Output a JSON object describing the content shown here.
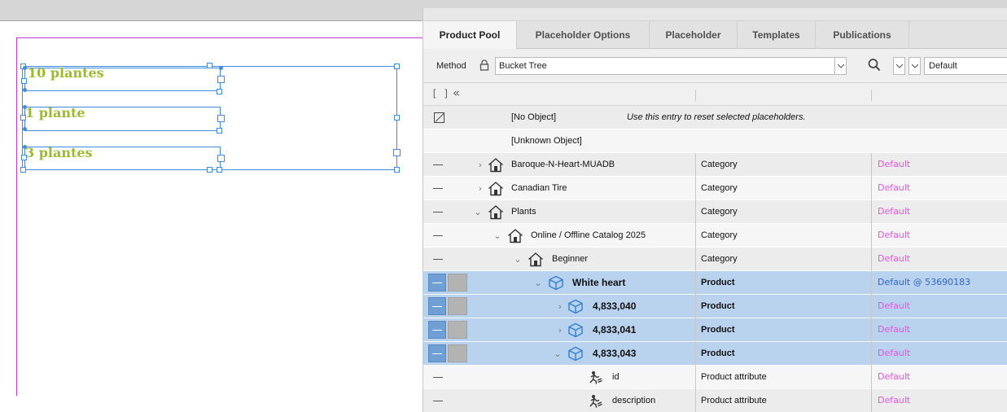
{
  "canvas": {
    "texts": [
      "10 plantes",
      "1 plante",
      "3 plantes"
    ]
  },
  "panel": {
    "tabs": [
      {
        "label": "Product Pool",
        "active": true
      },
      {
        "label": "Placeholder Options",
        "active": false
      },
      {
        "label": "Placeholder",
        "active": false
      },
      {
        "label": "Templates",
        "active": false
      },
      {
        "label": "Publications",
        "active": false
      }
    ],
    "method": {
      "label": "Method",
      "value": "Bucket Tree",
      "publication_select": "Default"
    },
    "special_rows": {
      "no_object": "[No Object]",
      "no_object_note": "Use this entry to reset selected placeholders.",
      "unknown_object": "[Unknown Object]"
    },
    "rows": [
      {
        "name": "Baroque-N-Heart-MUADB",
        "type": "Category",
        "pub": "Default"
      },
      {
        "name": "Canadian Tire",
        "type": "Category",
        "pub": "Default"
      },
      {
        "name": "Plants",
        "type": "Category",
        "pub": "Default"
      },
      {
        "name": "Online / Offline Catalog 2025",
        "type": "Category",
        "pub": "Default"
      },
      {
        "name": "Beginner",
        "type": "Category",
        "pub": "Default"
      },
      {
        "name": "White heart",
        "type": "Product",
        "pub": "Default @ 53690183"
      },
      {
        "name": "4,833,040",
        "type": "Product",
        "pub": "Default"
      },
      {
        "name": "4,833,041",
        "type": "Product",
        "pub": "Default"
      },
      {
        "name": "4,833,043",
        "type": "Product",
        "pub": "Default"
      },
      {
        "name": "id",
        "type": "Product attribute",
        "pub": "Default"
      },
      {
        "name": "description",
        "type": "Product attribute",
        "pub": "Default"
      }
    ],
    "colors": {
      "selection": "#b9d2ee",
      "publication_text": "#e256e2",
      "publication_text_selected": "#2f66cc",
      "frame_border": "#3e8be0",
      "plant_text": "#9bbb2b",
      "page_border": "#c03ad0"
    }
  }
}
